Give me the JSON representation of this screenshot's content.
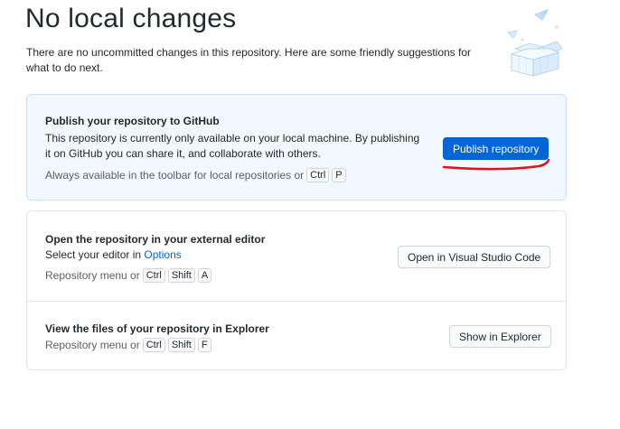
{
  "header": {
    "title": "No local changes",
    "subtitle": "There are no uncommitted changes in this repository. Here are some friendly suggestions for what to do next."
  },
  "publish": {
    "title": "Publish your repository to GitHub",
    "description": "This repository is currently only available on your local machine. By publishing it on GitHub you can share it, and collaborate with others.",
    "hint_prefix": "Always available in the toolbar for local repositories or",
    "keys": [
      "Ctrl",
      "P"
    ],
    "button_label": "Publish repository"
  },
  "editor": {
    "title": "Open the repository in your external editor",
    "desc_prefix": "Select your editor in",
    "desc_link": "Options",
    "hint_prefix": "Repository menu or",
    "keys": [
      "Ctrl",
      "Shift",
      "A"
    ],
    "button_label": "Open in Visual Studio Code"
  },
  "explorer": {
    "title": "View the files of your repository in Explorer",
    "hint_prefix": "Repository menu or",
    "keys": [
      "Ctrl",
      "Shift",
      "F"
    ],
    "button_label": "Show in Explorer"
  },
  "icons": {
    "illustration": "empty-box-illustration",
    "annotation": "red-underline-annotation"
  },
  "colors": {
    "accent": "#0366d6",
    "publish_card_bg": "#f1f8ff",
    "annotation": "#e0141e"
  }
}
